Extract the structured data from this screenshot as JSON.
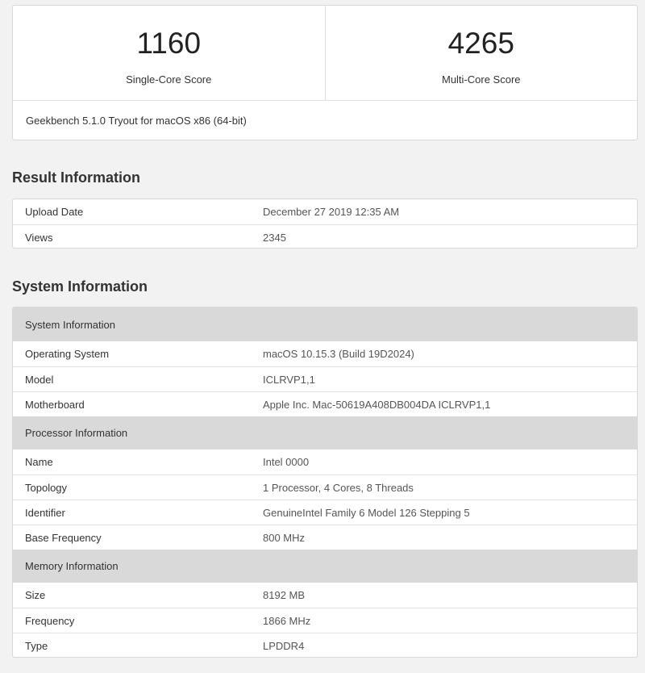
{
  "scores": {
    "single": {
      "value": "1160",
      "label": "Single-Core Score"
    },
    "multi": {
      "value": "4265",
      "label": "Multi-Core Score"
    },
    "version": "Geekbench 5.1.0 Tryout for macOS x86 (64-bit)"
  },
  "result": {
    "title": "Result Information",
    "rows": [
      {
        "key": "Upload Date",
        "value": "December 27 2019 12:35 AM"
      },
      {
        "key": "Views",
        "value": "2345"
      }
    ]
  },
  "system": {
    "title": "System Information",
    "groups": [
      {
        "header": "System Information",
        "rows": [
          {
            "key": "Operating System",
            "value": "macOS 10.15.3 (Build 19D2024)"
          },
          {
            "key": "Model",
            "value": "ICLRVP1,1"
          },
          {
            "key": "Motherboard",
            "value": "Apple Inc. Mac-50619A408DB004DA ICLRVP1,1"
          }
        ]
      },
      {
        "header": "Processor Information",
        "rows": [
          {
            "key": "Name",
            "value": "Intel 0000"
          },
          {
            "key": "Topology",
            "value": "1 Processor, 4 Cores, 8 Threads"
          },
          {
            "key": "Identifier",
            "value": "GenuineIntel Family 6 Model 126 Stepping 5"
          },
          {
            "key": "Base Frequency",
            "value": "800 MHz"
          }
        ]
      },
      {
        "header": "Memory Information",
        "rows": [
          {
            "key": "Size",
            "value": "8192 MB"
          },
          {
            "key": "Frequency",
            "value": "1866 MHz"
          },
          {
            "key": "Type",
            "value": "LPDDR4"
          }
        ]
      }
    ]
  }
}
